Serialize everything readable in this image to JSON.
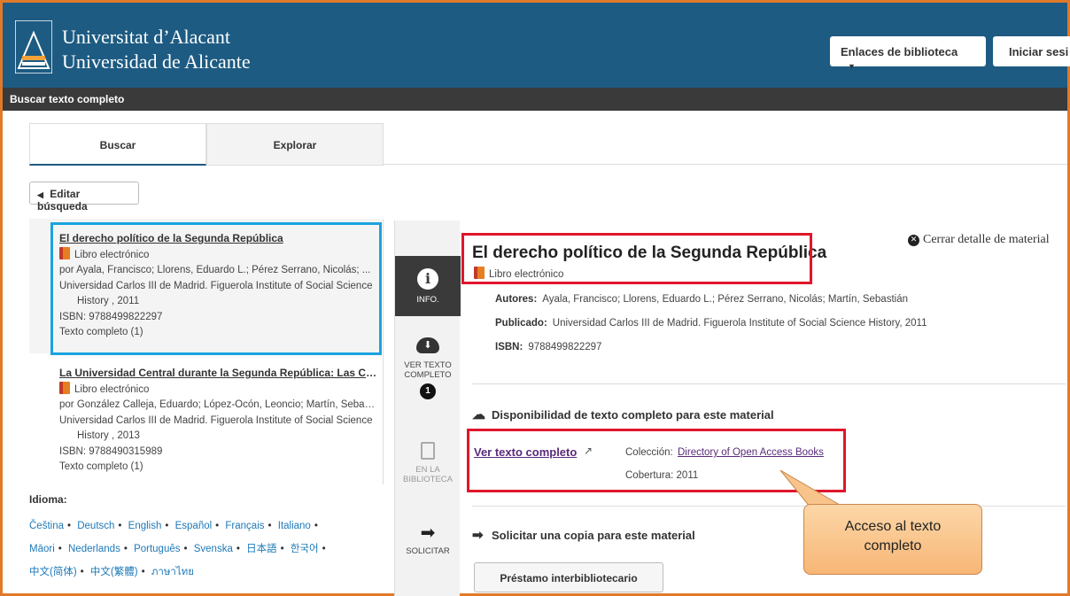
{
  "header": {
    "university_line1": "Universitat d’Alacant",
    "university_line2": "Universidad de Alicante",
    "library_links_label": "Enlaces de biblioteca",
    "login_label": "Iniciar sesi"
  },
  "subheader": {
    "title": "Buscar texto completo"
  },
  "tabs": [
    {
      "label": "Buscar"
    },
    {
      "label": "Explorar"
    }
  ],
  "edit_search_label": "Editar búsqueda",
  "results": [
    {
      "title": "El derecho político de la Segunda República",
      "type": "Libro electrónico",
      "authors": "por Ayala, Francisco; Llorens, Eduardo L.; Pérez Serrano, Nicolás; ...",
      "publisher": "Universidad Carlos III de Madrid. Figuerola Institute of Social Science",
      "publisher_cont": "History , 2011",
      "isbn": "ISBN: 9788499822297",
      "fulltext": "Texto completo (1)"
    },
    {
      "title": "La Universidad Central durante la Segunda República: Las Cie...",
      "type": "Libro electrónico",
      "authors": "por González Calleja, Eduardo; López-Ocón, Leoncio; Martín, Sebast...",
      "publisher": "Universidad Carlos III de Madrid. Figuerola Institute of Social Science",
      "publisher_cont": "History , 2013",
      "isbn": "ISBN: 9788490315989",
      "fulltext": "Texto completo (1)"
    }
  ],
  "languages": {
    "title": "Idioma:",
    "items": [
      "Čeština",
      "Deutsch",
      "English",
      "Español",
      "Français",
      "Italiano",
      "Māori",
      "Nederlands",
      "Português",
      "Svenska",
      "日本語",
      "한국어",
      "中文(简体)",
      "中文(繁體)",
      "ภาษาไทย"
    ]
  },
  "sidebar": {
    "info": "INFO.",
    "fulltext_line1": "VER TEXTO",
    "fulltext_line2": "COMPLETO",
    "fulltext_count": "1",
    "library_line1": "EN LA",
    "library_line2": "BIBLIOTECA",
    "request": "SOLICITAR"
  },
  "detail": {
    "title": "El derecho político de la Segunda República",
    "type": "Libro electrónico",
    "close_label": "Cerrar detalle de material",
    "authors_label": "Autores:",
    "authors": "Ayala, Francisco; Llorens, Eduardo L.; Pérez Serrano, Nicolás; Martín, Sebastián",
    "published_label": "Publicado:",
    "published": "Universidad Carlos III de Madrid. Figuerola Institute of Social Science History, 2011",
    "isbn_label": "ISBN:",
    "isbn": "9788499822297",
    "availability_heading": "Disponibilidad de texto completo para este material",
    "fulltext_link": "Ver texto completo",
    "collection_label": "Colección:",
    "collection_value": "Directory of Open Access Books",
    "coverage": "Cobertura: 2011",
    "request_heading": "Solicitar una copia para este material",
    "loan_button": "Préstamo interbibliotecario"
  },
  "callout": {
    "line1": "Acceso al texto",
    "line2": "completo"
  },
  "colors": {
    "header": "#1d5b82",
    "highlight_red": "#e0162b",
    "highlight_blue": "#1aa3e0",
    "callout": "#f7b676"
  }
}
